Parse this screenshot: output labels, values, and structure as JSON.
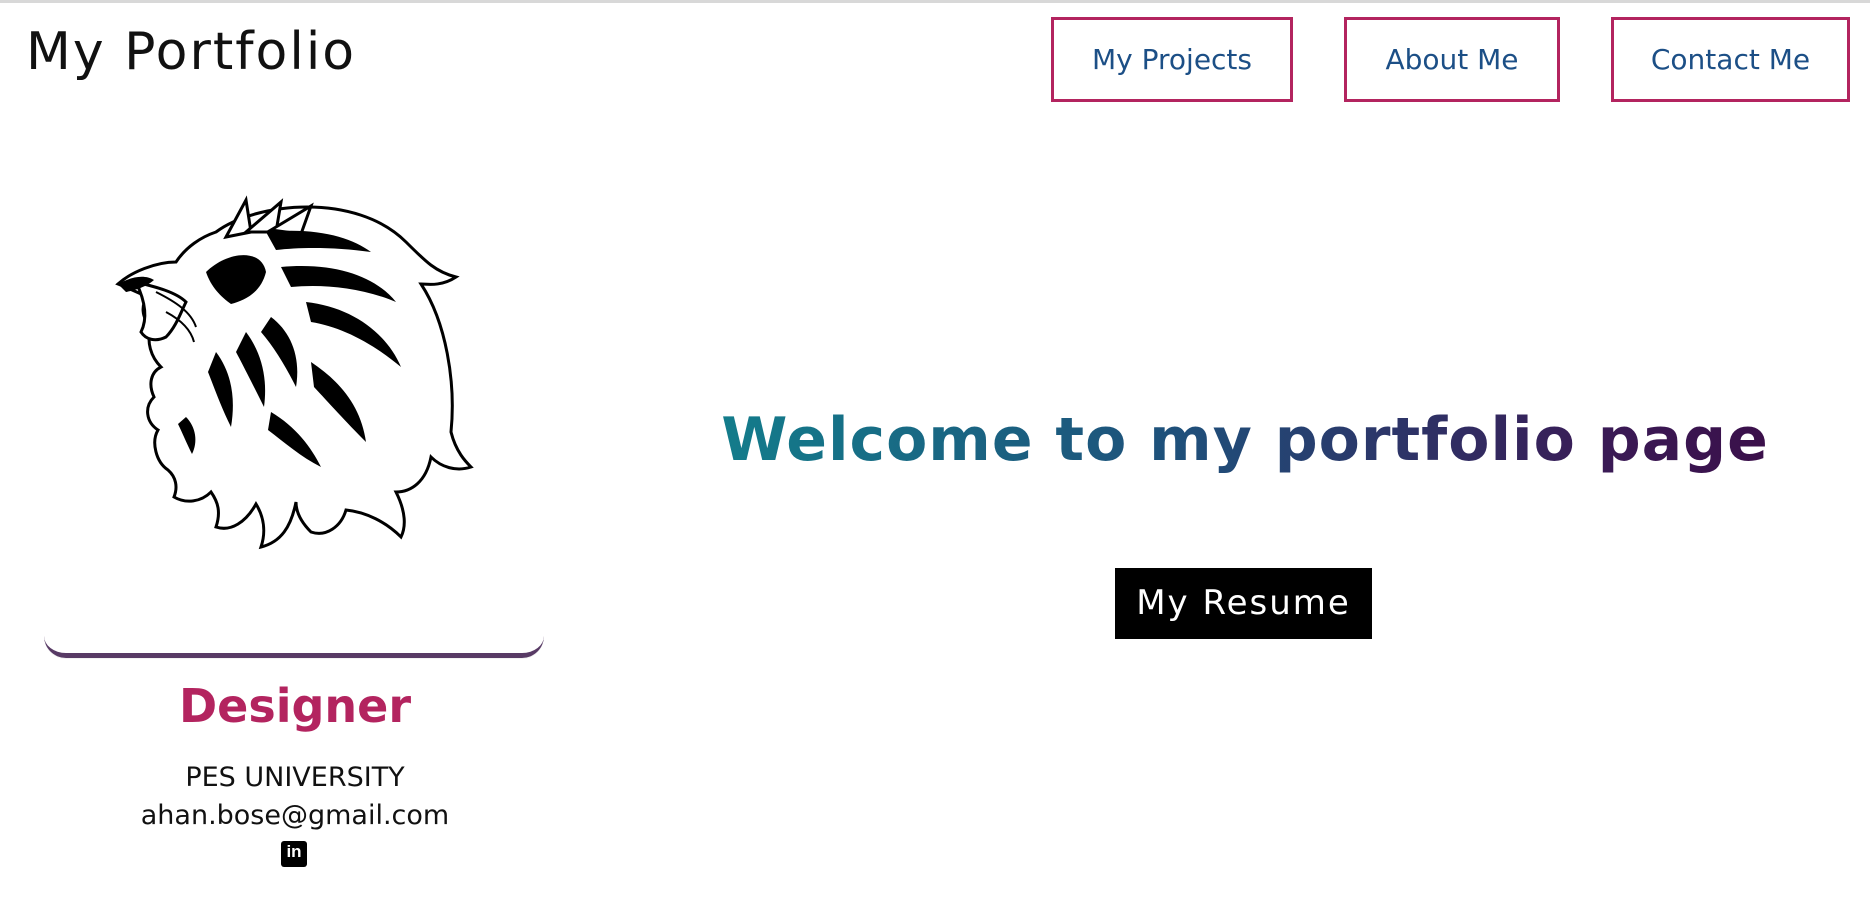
{
  "header": {
    "brand_title": "My Portfolio",
    "nav": {
      "projects_label": "My Projects",
      "about_label": "About Me",
      "contact_label": "Contact Me"
    }
  },
  "profile": {
    "image_icon": "lion-head-logo",
    "role": "Designer",
    "university": "PES UNIVERSITY",
    "email": "ahan.bose@gmail.com",
    "social_icon": "linkedin-icon",
    "social_icon_text": "in"
  },
  "hero": {
    "welcome_text": "Welcome to my portfolio page",
    "resume_label": "My Resume"
  },
  "colors": {
    "accent": "#b3245f",
    "nav_text": "#1c4f86",
    "gradient_start": "#11848e",
    "gradient_end": "#3b0a44",
    "card_underline": "#583a65"
  }
}
